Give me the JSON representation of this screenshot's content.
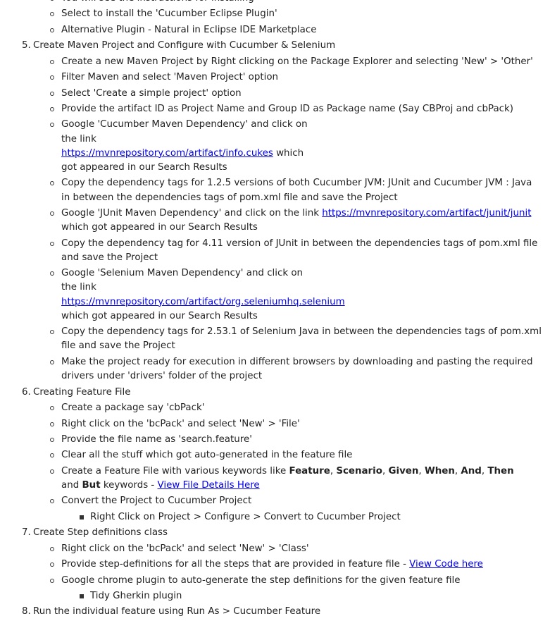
{
  "step4_tail": {
    "items": [
      "You will see the instructions for installing",
      "Select to install the 'Cucumber Eclipse Plugin'",
      "Alternative Plugin - Natural in Eclipse IDE Marketplace"
    ]
  },
  "step5": {
    "number": "5.",
    "title": "Create Maven Project and Configure with Cucumber & Selenium",
    "item1": "Create a new Maven Project by Right clicking on the Package Explorer and selecting 'New' > 'Other'",
    "item2": "Filter Maven and select 'Maven Project' option",
    "item3": "Select 'Create a simple project' option",
    "item4": "Provide the artifact ID as Project Name and Group ID as Package name  (Say CBProj and cbPack)",
    "item5_pre": "Google 'Cucumber Maven Dependency' and click on the link ",
    "item5_link": "https://mvnrepository.com/artifact/info.cukes",
    "item5_post": " which got appeared in our Search Results",
    "item6": "Copy the dependency tags for 1.2.5 versions of both Cucumber JVM: JUnit and Cucumber JVM : Java in between the dependencies tags of pom.xml file and save the Project",
    "item7_pre": "Google 'JUnit Maven Dependency' and click on the link ",
    "item7_link": "https://mvnrepository.com/artifact/junit/junit",
    "item7_post": " which got appeared in our Search Results",
    "item8": "Copy the dependency tag for 4.11 version of JUnit in between the dependencies tags of pom.xml file and save the Project",
    "item9_pre": "Google 'Selenium Maven Dependency' and click on the link ",
    "item9_link": "https://mvnrepository.com/artifact/org.seleniumhq.selenium",
    "item9_post": " which got appeared in our Search Results",
    "item10": "Copy the dependency tags for 2.53.1 of Selenium Java in between the dependencies tags of pom.xml file and save the Project",
    "item11": "Make the project ready for execution in different browsers by downloading and pasting the required drivers under 'drivers' folder of the project"
  },
  "step6": {
    "number": "6.",
    "title": "Creating Feature File",
    "item1": "Create a package say 'cbPack'",
    "item2": "Right click on the 'bcPack' and select 'New' > 'File'",
    "item3": "Provide the file name as 'search.feature'",
    "item4": "Clear all the stuff which got auto-generated in the feature file",
    "item5_pre": "Create a Feature File with various keywords like ",
    "kw_feature": "Feature",
    "sep1": ", ",
    "kw_scenario": "Scenario",
    "sep2": ", ",
    "kw_given": "Given",
    "sep3": ", ",
    "kw_when": "When",
    "sep4": ", ",
    "kw_and": "And",
    "sep5": ", ",
    "kw_then": "Then",
    "sep6": " and ",
    "kw_but": "But",
    "item5_mid": " keywords - ",
    "item5_link": "View File Details Here",
    "item6": "Convert the Project to Cucumber Project",
    "item6_sub": "Right Click on Project > Configure > Convert to Cucumber Project"
  },
  "step7": {
    "number": "7.",
    "title": "Create Step definitions class",
    "item1": "Right click on the 'bcPack' and select 'New' > 'Class'",
    "item2_pre": "Provide step-definitions for all the steps that are provided in feature file - ",
    "item2_link": "View Code here",
    "item3": "Google chrome plugin to auto-generate the step definitions for the given feature file",
    "item3_sub": "Tidy Gherkin plugin"
  },
  "step8": {
    "number": "8.",
    "title": "Run the individual feature using Run As > Cucumber Feature"
  }
}
